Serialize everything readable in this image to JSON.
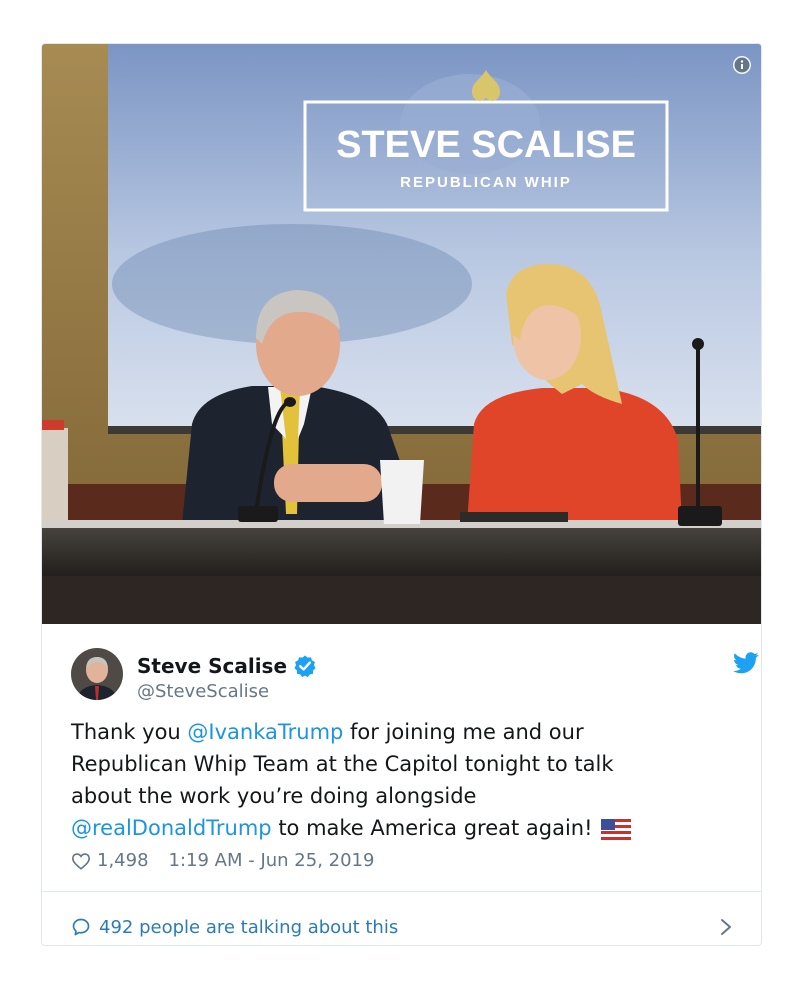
{
  "embed": {
    "photo": {
      "banner_title": "STEVE SCALISE",
      "banner_subtitle": "REPUBLICAN WHIP"
    },
    "author": {
      "name": "Steve Scalise",
      "handle": "@SteveScalise",
      "verified": true
    },
    "tweet": {
      "lines": [
        {
          "before": "Thank you ",
          "mention": "@IvankaTrump",
          "after": " for joining me and our"
        },
        {
          "text": "Republican Whip Team at the Capitol tonight to talk"
        },
        {
          "text": "about the work you’re doing alongside"
        },
        {
          "mention": "@realDonaldTrump",
          "after": " to make America great again!"
        }
      ],
      "emoji": "us-flag-emoji"
    },
    "meta": {
      "likes": "1,498",
      "timestamp": "1:19 AM - Jun 25, 2019"
    },
    "footer": {
      "talking": "492 people are talking about this"
    },
    "colors": {
      "accent": "#1b95e0",
      "link": "#2b7bb9",
      "muted": "#657786",
      "border": "#e1e8ed",
      "dress": "#e0452a"
    },
    "icons": [
      "info-icon",
      "verified-badge-icon",
      "twitter-bird-icon",
      "heart-icon",
      "speech-bubble-icon",
      "chevron-right-icon"
    ]
  }
}
